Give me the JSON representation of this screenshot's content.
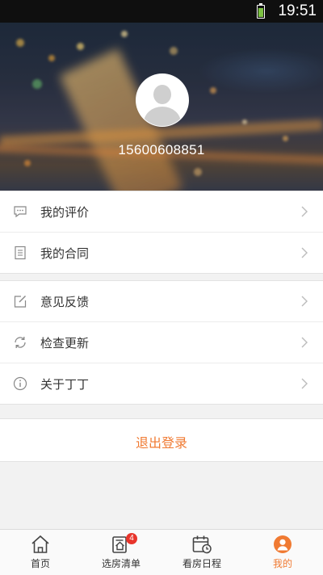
{
  "status_bar": {
    "time": "19:51"
  },
  "profile": {
    "phone": "15600608851"
  },
  "menu_groups": [
    {
      "items": [
        {
          "label": "我的评价",
          "icon": "comment-icon"
        },
        {
          "label": "我的合同",
          "icon": "document-icon"
        }
      ]
    },
    {
      "items": [
        {
          "label": "意见反馈",
          "icon": "edit-icon"
        },
        {
          "label": "检查更新",
          "icon": "refresh-icon"
        },
        {
          "label": "关于丁丁",
          "icon": "info-icon"
        }
      ]
    }
  ],
  "logout": {
    "label": "退出登录"
  },
  "tabbar": {
    "tabs": [
      {
        "label": "首页",
        "icon": "home-icon",
        "active": false
      },
      {
        "label": "选房清单",
        "icon": "house-list-icon",
        "badge": "4",
        "active": false
      },
      {
        "label": "看房日程",
        "icon": "calendar-clock-icon",
        "active": false
      },
      {
        "label": "我的",
        "icon": "user-icon",
        "active": true
      }
    ]
  },
  "colors": {
    "accent": "#f07a32",
    "badge": "#e8352c"
  }
}
